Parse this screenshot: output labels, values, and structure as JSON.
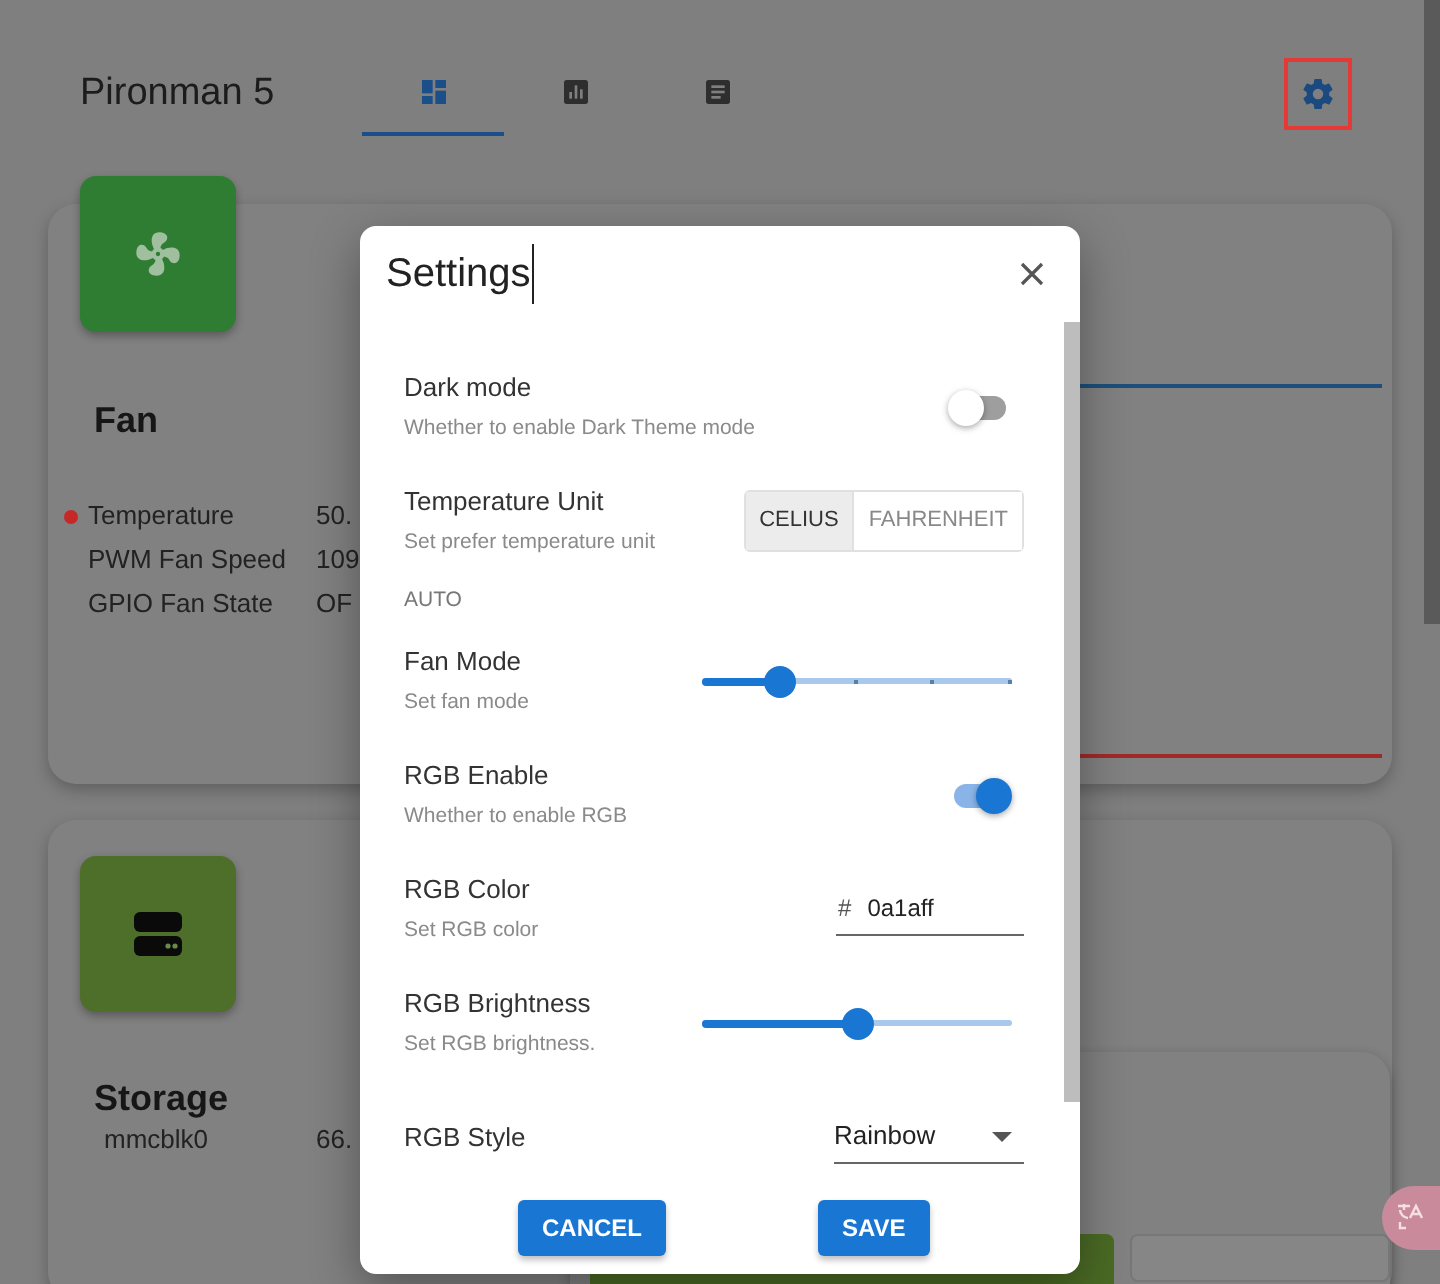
{
  "header": {
    "title": "Pironman 5",
    "tabs": [
      {
        "kind": "dashboard",
        "selected": true
      },
      {
        "kind": "chart",
        "selected": false
      },
      {
        "kind": "log",
        "selected": false
      }
    ]
  },
  "fan_card": {
    "title": "Fan",
    "rows": [
      {
        "label": "Temperature",
        "value": "50.",
        "color": "#c62828"
      },
      {
        "label": "PWM Fan Speed",
        "value": "109"
      },
      {
        "label": "GPIO Fan State",
        "value": "OF"
      }
    ]
  },
  "storage_card": {
    "title": "Storage",
    "rows": [
      {
        "label": "mmcblk0",
        "value": "66."
      }
    ]
  },
  "dialog": {
    "title": "Settings",
    "settings": [
      {
        "kind": "toggle",
        "label": "Dark mode",
        "description": "Whether to enable Dark Theme mode",
        "on": false
      },
      {
        "kind": "segmented",
        "label": "Temperature Unit",
        "description": "Set prefer temperature unit",
        "options": [
          {
            "label": "CELIUS",
            "selected": true
          },
          {
            "label": "FAHRENHEIT",
            "selected": false
          }
        ]
      },
      {
        "kind": "section",
        "label": "AUTO"
      },
      {
        "kind": "slider",
        "label": "Fan Mode",
        "description": "Set fan mode",
        "level": 0.25,
        "steps": true
      },
      {
        "kind": "toggle",
        "label": "RGB Enable",
        "description": "Whether to enable RGB",
        "on": true
      },
      {
        "kind": "color",
        "label": "RGB Color",
        "description": "Set RGB color",
        "prefix": "#",
        "value": "0a1aff"
      },
      {
        "kind": "slider",
        "label": "RGB Brightness",
        "description": "Set RGB brightness.",
        "level": 0.5,
        "steps": false
      },
      {
        "kind": "select",
        "label": "RGB Style",
        "value": "Rainbow"
      }
    ],
    "buttons": [
      "CANCEL",
      "SAVE"
    ]
  }
}
